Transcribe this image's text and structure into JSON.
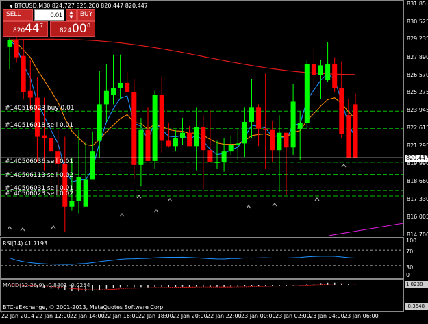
{
  "header": {
    "symbol_line": "BTCUSD,M30  824.727 825.200 820.447 820.447"
  },
  "trade_panel": {
    "sell_label": "SELL",
    "buy_label": "BUY",
    "lot_value": "0.01",
    "sell_price_prefix": "820",
    "sell_price_big": "44",
    "sell_price_sup": "7",
    "buy_price_prefix": "824",
    "buy_price_big": "00",
    "buy_price_sup": "0"
  },
  "price_axis": [
    "831.85",
    "830.525",
    "829.235",
    "827.890",
    "826.570",
    "825.275",
    "823.945",
    "822.615",
    "821.295",
    "819.990",
    "818.660",
    "817.330",
    "816.005",
    "814.700"
  ],
  "current_price": "820.447",
  "orders": [
    {
      "label": "#140516023 buy 0.01"
    },
    {
      "label": "#140516018 sell 0.01"
    },
    {
      "label": "#140506036 sell 0.01"
    },
    {
      "label": "#140506113 sell 0.02"
    },
    {
      "label": "#140506031 sell 0.01"
    },
    {
      "label": "#140506023 sell 0.02"
    }
  ],
  "rsi": {
    "label": "RSI(14) 41.7193",
    "levels": [
      "100",
      "70",
      "30",
      "0"
    ]
  },
  "macd": {
    "label": "MACD(12,26,9) -0.8401 -0.0264",
    "axis": [
      "1.0238",
      "-8.3648"
    ]
  },
  "copyright": "BTC-eExchange, © 2001-2013, MetaQuotes Software Corp.",
  "time_axis": [
    "22 Jan 2014",
    "22 Jan 12:00",
    "22 Jan 14:00",
    "22 Jan 16:00",
    "22 Jan 18:00",
    "22 Jan 20:00",
    "22 Jan 22:00",
    "23 Jan 00:00",
    "23 Jan 02:00",
    "23 Jan 04:00",
    "23 Jan 06:00"
  ],
  "colors": {
    "bull": "#00ff00",
    "bear": "#ff0000",
    "ma_fast": "#1e90ff",
    "ma_mid": "#ff8c00",
    "ma_slow": "#e81c1c",
    "order_line": "#00c000",
    "rsi_line": "#1e90ff",
    "macd_line": "#e81c1c",
    "price_line": "#ffffff"
  },
  "chart_data": {
    "type": "candlestick",
    "candles": [
      {
        "o": 828.7,
        "h": 829.3,
        "l": 827.0,
        "c": 829.2
      },
      {
        "o": 829.2,
        "h": 829.4,
        "l": 827.5,
        "c": 827.9
      },
      {
        "o": 828.0,
        "h": 829.2,
        "l": 824.8,
        "c": 825.3
      },
      {
        "o": 825.4,
        "h": 827.7,
        "l": 823.9,
        "c": 824.9
      },
      {
        "o": 824.9,
        "h": 826.4,
        "l": 820.1,
        "c": 822.0
      },
      {
        "o": 822.1,
        "h": 824.9,
        "l": 819.5,
        "c": 821.9
      },
      {
        "o": 821.9,
        "h": 823.5,
        "l": 817.5,
        "c": 820.9
      },
      {
        "o": 820.9,
        "h": 822.5,
        "l": 817.6,
        "c": 820.0
      },
      {
        "o": 820.0,
        "h": 822.0,
        "l": 814.9,
        "c": 816.8
      },
      {
        "o": 816.8,
        "h": 820.4,
        "l": 816.5,
        "c": 817.2
      },
      {
        "o": 817.2,
        "h": 822.5,
        "l": 816.3,
        "c": 819.0
      },
      {
        "o": 816.8,
        "h": 821.6,
        "l": 816.8,
        "c": 818.8
      },
      {
        "o": 818.8,
        "h": 822.4,
        "l": 819.2,
        "c": 820.9
      },
      {
        "o": 821.7,
        "h": 826.9,
        "l": 820.4,
        "c": 824.4
      },
      {
        "o": 824.4,
        "h": 827.4,
        "l": 823.1,
        "c": 825.4
      },
      {
        "o": 825.1,
        "h": 828.1,
        "l": 824.4,
        "c": 825.6
      },
      {
        "o": 825.6,
        "h": 828.1,
        "l": 824.8,
        "c": 826.0
      },
      {
        "o": 826.0,
        "h": 826.8,
        "l": 825.3,
        "c": 825.3
      },
      {
        "o": 825.3,
        "h": 826.3,
        "l": 818.9,
        "c": 819.9
      },
      {
        "o": 819.9,
        "h": 823.4,
        "l": 818.3,
        "c": 822.5
      },
      {
        "o": 822.5,
        "h": 824.2,
        "l": 820.2,
        "c": 820.2
      },
      {
        "o": 820.2,
        "h": 825.4,
        "l": 819.6,
        "c": 825.1
      },
      {
        "o": 825.1,
        "h": 826.4,
        "l": 820.8,
        "c": 821.7
      },
      {
        "o": 821.7,
        "h": 823.0,
        "l": 821.2,
        "c": 821.3
      },
      {
        "o": 821.3,
        "h": 822.5,
        "l": 820.9,
        "c": 821.9
      },
      {
        "o": 821.9,
        "h": 823.4,
        "l": 821.4,
        "c": 822.3
      },
      {
        "o": 822.3,
        "h": 822.8,
        "l": 821.3,
        "c": 821.3
      },
      {
        "o": 821.3,
        "h": 824.2,
        "l": 819.5,
        "c": 822.7
      },
      {
        "o": 822.7,
        "h": 823.6,
        "l": 818.1,
        "c": 821.0
      },
      {
        "o": 821.0,
        "h": 824.0,
        "l": 820.3,
        "c": 820.1
      },
      {
        "o": 820.1,
        "h": 821.7,
        "l": 819.6,
        "c": 820.1
      },
      {
        "o": 820.1,
        "h": 821.9,
        "l": 819.4,
        "c": 820.9
      },
      {
        "o": 820.9,
        "h": 822.1,
        "l": 820.6,
        "c": 821.4
      },
      {
        "o": 821.4,
        "h": 822.6,
        "l": 820.3,
        "c": 821.5
      },
      {
        "o": 821.5,
        "h": 824.2,
        "l": 820.5,
        "c": 823.1
      },
      {
        "o": 823.1,
        "h": 826.3,
        "l": 821.9,
        "c": 824.2
      },
      {
        "o": 824.2,
        "h": 824.4,
        "l": 821.3,
        "c": 822.6
      },
      {
        "o": 822.6,
        "h": 826.7,
        "l": 819.6,
        "c": 822.5
      },
      {
        "o": 822.5,
        "h": 823.2,
        "l": 820.1,
        "c": 821.0
      },
      {
        "o": 821.0,
        "h": 823.6,
        "l": 817.9,
        "c": 822.3
      },
      {
        "o": 822.3,
        "h": 822.3,
        "l": 817.7,
        "c": 821.2
      },
      {
        "o": 821.2,
        "h": 825.9,
        "l": 820.6,
        "c": 824.6
      },
      {
        "o": 822.6,
        "h": 823.9,
        "l": 820.3,
        "c": 823.0
      },
      {
        "o": 823.0,
        "h": 827.7,
        "l": 822.6,
        "c": 827.4
      },
      {
        "o": 827.4,
        "h": 828.5,
        "l": 825.8,
        "c": 826.6
      },
      {
        "o": 826.6,
        "h": 827.7,
        "l": 824.8,
        "c": 827.3
      },
      {
        "o": 826.2,
        "h": 829.0,
        "l": 826.1,
        "c": 827.4
      },
      {
        "o": 827.4,
        "h": 827.9,
        "l": 825.3,
        "c": 825.6
      },
      {
        "o": 825.6,
        "h": 827.6,
        "l": 821.9,
        "c": 822.2
      },
      {
        "o": 823.6,
        "h": 824.8,
        "l": 820.6,
        "c": 820.4
      },
      {
        "o": 824.4,
        "h": 825.2,
        "l": 820.4,
        "c": 820.4
      }
    ],
    "order_levels": [
      823.9,
      822.6,
      820.1,
      819.2,
      818.0,
      817.6
    ],
    "ylim": [
      814.7,
      831.85
    ]
  }
}
